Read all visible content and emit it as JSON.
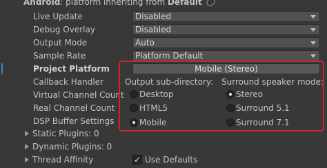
{
  "header": {
    "platform": "Android",
    "suffix": ": platform inheriting from ",
    "source": "Default"
  },
  "settings": [
    {
      "label": "Live Update",
      "value": "Disabled"
    },
    {
      "label": "Debug Overlay",
      "value": "Disabled"
    },
    {
      "label": "Output Mode",
      "value": "Auto"
    },
    {
      "label": "Sample Rate",
      "value": "Platform Default"
    }
  ],
  "project_platform": {
    "label": "Project Platform",
    "value": "Mobile (Stereo)"
  },
  "other_labels": {
    "callback_handler": "Callback Handler",
    "virtual_channel_count": "Virtual Channel Count",
    "real_channel_count": "Real Channel Count",
    "dsp_buffer_settings": "DSP Buffer Settings"
  },
  "output_subdir": {
    "title": "Output sub-directory:",
    "options": [
      {
        "label": "Desktop",
        "selected": false
      },
      {
        "label": "HTML5",
        "selected": false
      },
      {
        "label": "Mobile",
        "selected": true
      }
    ]
  },
  "speaker_mode": {
    "title": "Surround speaker mode:",
    "options": [
      {
        "label": "Stereo",
        "selected": true
      },
      {
        "label": "Surround 5.1",
        "selected": false
      },
      {
        "label": "Surround 7.1",
        "selected": false
      }
    ]
  },
  "foldouts": {
    "static_plugins": "Static Plugins: 0",
    "dynamic_plugins": "Dynamic Plugins: 0",
    "thread_affinity": "Thread Affinity"
  },
  "use_defaults": {
    "label": "Use Defaults",
    "checked": true,
    "check_glyph": "✓"
  },
  "colors": {
    "background": "#383838",
    "field": "#515151",
    "highlight_border": "#d0242a"
  }
}
